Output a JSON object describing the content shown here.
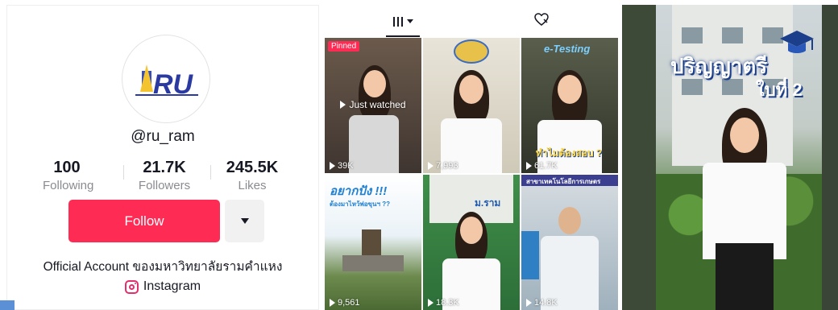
{
  "profile": {
    "avatar_text": "RU",
    "handle": "@ru_ram",
    "stats": [
      {
        "value": "100",
        "label": "Following"
      },
      {
        "value": "21.7K",
        "label": "Followers"
      },
      {
        "value": "245.5K",
        "label": "Likes"
      }
    ],
    "follow_label": "Follow",
    "bio": "Official Account ของมหาวิทยาลัยรามคำแหง",
    "link_label": "Instagram",
    "colors": {
      "follow": "#fe2c55",
      "text": "#161823",
      "muted": "#8a8b91"
    }
  },
  "grid": {
    "tabs": [
      {
        "icon": "videos-grid-icon"
      },
      {
        "icon": "liked-heart-icon"
      }
    ],
    "videos": [
      {
        "badge": "Pinned",
        "overlay": "Just watched",
        "views": "39K",
        "caption": ""
      },
      {
        "views": "7,993",
        "caption": ""
      },
      {
        "views": "61.7K",
        "caption": "ทำไมต้องสอบ ?",
        "top_caption": "e-Testing"
      },
      {
        "views": "9,561",
        "caption": "อยากปัง !!!",
        "sub_caption": "ต้องมาไหว้พ่อขุนฯ ??"
      },
      {
        "views": "18.3K",
        "caption": "ม.ราม"
      },
      {
        "views": "14.8K",
        "caption": "สาขาเทคโนโลยีการเกษตร"
      }
    ]
  },
  "featured": {
    "title": "ปริญญาตรี",
    "subtitle": "ใบที่ 2"
  }
}
